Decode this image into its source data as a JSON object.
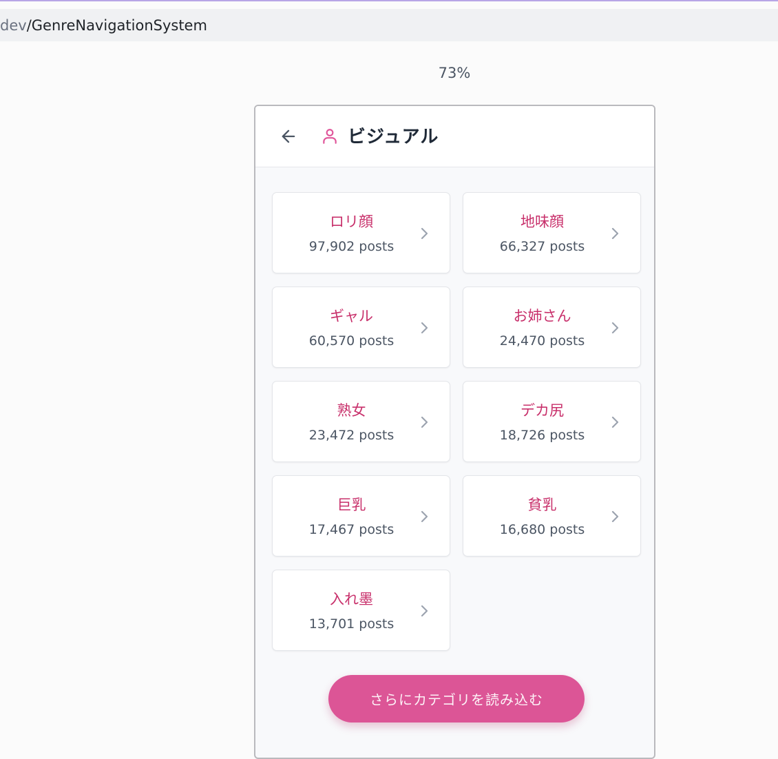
{
  "browser": {
    "url_prefix": "dev",
    "url_path": "/GenreNavigationSystem"
  },
  "zoom_level": "73%",
  "header": {
    "title": "ビジュアル",
    "back_icon": "arrow-left-icon",
    "category_icon": "user-icon"
  },
  "categories": [
    {
      "name": "ロリ顔",
      "count": "97,902 posts"
    },
    {
      "name": "地味顔",
      "count": "66,327 posts"
    },
    {
      "name": "ギャル",
      "count": "60,570 posts"
    },
    {
      "name": "お姉さん",
      "count": "24,470 posts"
    },
    {
      "name": "熟女",
      "count": "23,472 posts"
    },
    {
      "name": "デカ尻",
      "count": "18,726 posts"
    },
    {
      "name": "巨乳",
      "count": "17,467 posts"
    },
    {
      "name": "貧乳",
      "count": "16,680 posts"
    },
    {
      "name": "入れ墨",
      "count": "13,701 posts"
    }
  ],
  "load_more_label": "さらにカテゴリを読み込む",
  "colors": {
    "accent": "#dc5596",
    "category_text": "#c8306b",
    "title_text": "#1f2937"
  }
}
